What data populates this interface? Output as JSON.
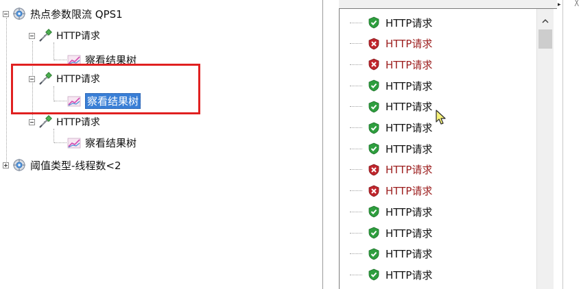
{
  "left_tree": {
    "nodes": [
      {
        "label": "热点参数限流 QPS1",
        "type": "thread-group",
        "expander": "minus"
      },
      {
        "label": "HTTP请求",
        "type": "sampler",
        "expander": "minus"
      },
      {
        "label": "察看结果树",
        "type": "listener"
      },
      {
        "label": "HTTP请求",
        "type": "sampler",
        "expander": "minus"
      },
      {
        "label": "察看结果树",
        "type": "listener",
        "selected": true
      },
      {
        "label": "HTTP请求",
        "type": "sampler",
        "expander": "minus"
      },
      {
        "label": "察看结果树",
        "type": "listener"
      },
      {
        "label": "阈值类型-线程数<2",
        "type": "thread-group",
        "expander": "plus"
      }
    ]
  },
  "results": {
    "rows": [
      {
        "label": "HTTP请求",
        "status": "success"
      },
      {
        "label": "HTTP请求",
        "status": "failure"
      },
      {
        "label": "HTTP请求",
        "status": "failure"
      },
      {
        "label": "HTTP请求",
        "status": "success"
      },
      {
        "label": "HTTP请求",
        "status": "success"
      },
      {
        "label": "HTTP请求",
        "status": "success"
      },
      {
        "label": "HTTP请求",
        "status": "success"
      },
      {
        "label": "HTTP请求",
        "status": "failure"
      },
      {
        "label": "HTTP请求",
        "status": "failure"
      },
      {
        "label": "HTTP请求",
        "status": "success"
      },
      {
        "label": "HTTP请求",
        "status": "success"
      },
      {
        "label": "HTTP请求",
        "status": "success"
      },
      {
        "label": "HTTP请求",
        "status": "success"
      }
    ]
  },
  "colors": {
    "highlight_border": "#e02020",
    "selection_bg": "#3a7fd6",
    "success_green": "#2e9e3e",
    "failure_red": "#c0262d",
    "failure_text": "#9b1c1c"
  },
  "icons": {
    "thread_group": "gear-icon",
    "sampler": "pipette-icon",
    "listener": "chart-icon",
    "success": "shield-check-icon",
    "failure": "shield-x-icon",
    "scroll_up": "chevron-up-icon",
    "cursor": "mouse-pointer-icon"
  }
}
